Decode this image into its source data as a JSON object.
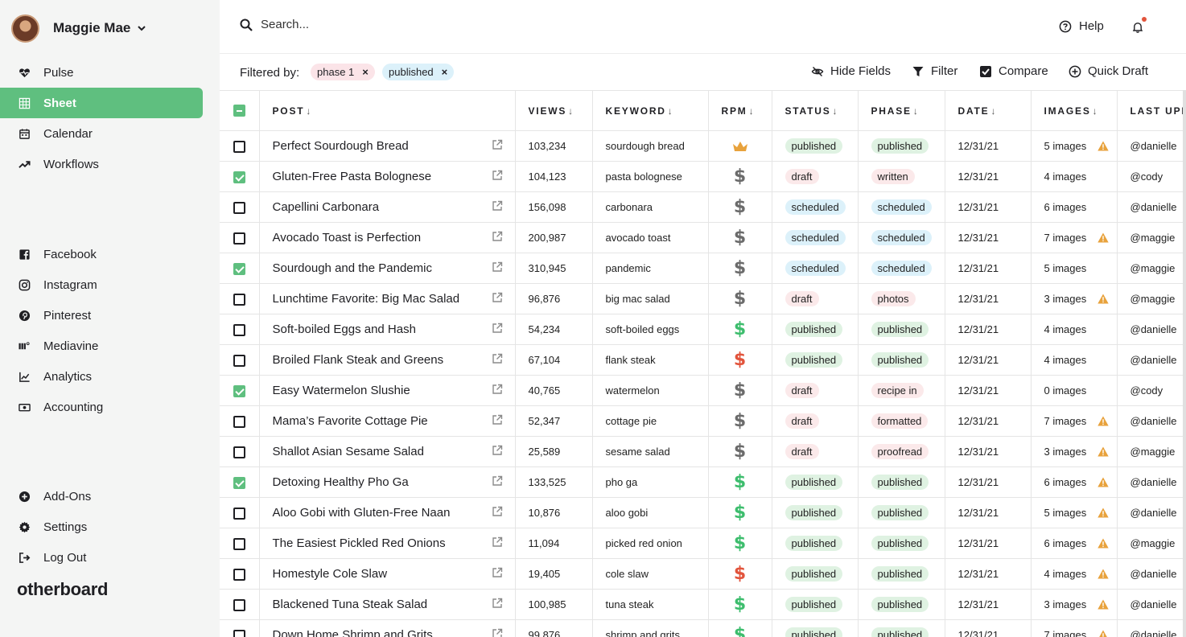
{
  "user": {
    "name": "Maggie Mae"
  },
  "nav_primary": [
    {
      "label": "Pulse",
      "icon": "heart-pulse-icon"
    },
    {
      "label": "Sheet",
      "icon": "grid-icon",
      "active": true
    },
    {
      "label": "Calendar",
      "icon": "calendar-icon"
    },
    {
      "label": "Workflows",
      "icon": "trend-icon"
    }
  ],
  "nav_secondary": [
    {
      "label": "Facebook",
      "icon": "facebook-icon"
    },
    {
      "label": "Instagram",
      "icon": "instagram-icon"
    },
    {
      "label": "Pinterest",
      "icon": "pinterest-icon"
    },
    {
      "label": "Mediavine",
      "icon": "mediavine-icon"
    },
    {
      "label": "Analytics",
      "icon": "analytics-icon"
    },
    {
      "label": "Accounting",
      "icon": "accounting-icon"
    }
  ],
  "nav_bottom": [
    {
      "label": "Add-Ons",
      "icon": "plus-circle-icon"
    },
    {
      "label": "Settings",
      "icon": "gear-icon"
    },
    {
      "label": "Log Out",
      "icon": "logout-icon"
    }
  ],
  "brand": "otherboard",
  "search": {
    "placeholder": "Search..."
  },
  "help_label": "Help",
  "filter": {
    "label": "Filtered by:",
    "chips": [
      {
        "label": "phase 1",
        "x": "×"
      },
      {
        "label": "published",
        "x": "×"
      }
    ]
  },
  "actions": {
    "hide_fields": "Hide Fields",
    "filter": "Filter",
    "compare": "Compare",
    "quick_draft": "Quick Draft"
  },
  "columns": {
    "post": "POST",
    "views": "VIEWS",
    "keyword": "KEYWORD",
    "rpm": "RPM",
    "status": "STATUS",
    "phase": "PHASE",
    "date": "DATE",
    "images": "IMAGES",
    "last_updated": "LAST UPD"
  },
  "sort_arrow": "↓",
  "rows": [
    {
      "checked": false,
      "post": "Perfect Sourdough Bread",
      "views": "103,234",
      "keyword": "sourdough bread",
      "rpm": "crown",
      "status": "published",
      "phase": "published",
      "date": "12/31/21",
      "images": "5 images",
      "warn": true,
      "user": "@danielle"
    },
    {
      "checked": true,
      "post": "Gluten-Free Pasta Bolognese",
      "views": "104,123",
      "keyword": "pasta bolognese",
      "rpm": "grey",
      "status": "draft",
      "phase": "written",
      "date": "12/31/21",
      "images": "4 images",
      "warn": false,
      "user": "@cody"
    },
    {
      "checked": false,
      "post": "Capellini Carbonara",
      "views": "156,098",
      "keyword": "carbonara",
      "rpm": "grey",
      "status": "scheduled",
      "phase": "scheduled",
      "date": "12/31/21",
      "images": "6 images",
      "warn": false,
      "user": "@danielle"
    },
    {
      "checked": false,
      "post": "Avocado Toast is Perfection",
      "views": "200,987",
      "keyword": "avocado toast",
      "rpm": "grey",
      "status": "scheduled",
      "phase": "scheduled",
      "date": "12/31/21",
      "images": "7 images",
      "warn": true,
      "user": "@maggie"
    },
    {
      "checked": true,
      "post": "Sourdough and the Pandemic",
      "views": "310,945",
      "keyword": "pandemic",
      "rpm": "grey",
      "status": "scheduled",
      "phase": "scheduled",
      "date": "12/31/21",
      "images": "5 images",
      "warn": false,
      "user": "@maggie"
    },
    {
      "checked": false,
      "post": "Lunchtime Favorite: Big Mac Salad",
      "views": "96,876",
      "keyword": "big mac salad",
      "rpm": "grey",
      "status": "draft",
      "phase": "photos",
      "date": "12/31/21",
      "images": "3 images",
      "warn": true,
      "user": "@maggie"
    },
    {
      "checked": false,
      "post": "Soft-boiled Eggs and Hash",
      "views": "54,234",
      "keyword": "soft-boiled eggs",
      "rpm": "green",
      "status": "published",
      "phase": "published",
      "date": "12/31/21",
      "images": "4 images",
      "warn": false,
      "user": "@danielle"
    },
    {
      "checked": false,
      "post": "Broiled Flank Steak and Greens",
      "views": "67,104",
      "keyword": "flank steak",
      "rpm": "red",
      "status": "published",
      "phase": "published",
      "date": "12/31/21",
      "images": "4 images",
      "warn": false,
      "user": "@danielle"
    },
    {
      "checked": true,
      "post": "Easy Watermelon Slushie",
      "views": "40,765",
      "keyword": "watermelon",
      "rpm": "grey",
      "status": "draft",
      "phase": "recipe in",
      "date": "12/31/21",
      "images": "0 images",
      "warn": false,
      "user": "@cody"
    },
    {
      "checked": false,
      "post": "Mama’s Favorite Cottage Pie",
      "views": "52,347",
      "keyword": "cottage pie",
      "rpm": "grey",
      "status": "draft",
      "phase": "formatted",
      "date": "12/31/21",
      "images": "7 images",
      "warn": true,
      "user": "@danielle"
    },
    {
      "checked": false,
      "post": "Shallot Asian Sesame Salad",
      "views": "25,589",
      "keyword": "sesame salad",
      "rpm": "grey",
      "status": "draft",
      "phase": "proofread",
      "date": "12/31/21",
      "images": "3 images",
      "warn": true,
      "user": "@maggie"
    },
    {
      "checked": true,
      "post": "Detoxing Healthy Pho Ga",
      "views": "133,525",
      "keyword": "pho ga",
      "rpm": "green",
      "status": "published",
      "phase": "published",
      "date": "12/31/21",
      "images": "6 images",
      "warn": true,
      "user": "@danielle"
    },
    {
      "checked": false,
      "post": "Aloo Gobi with Gluten-Free Naan",
      "views": "10,876",
      "keyword": "aloo gobi",
      "rpm": "green",
      "status": "published",
      "phase": "published",
      "date": "12/31/21",
      "images": "5 images",
      "warn": true,
      "user": "@danielle"
    },
    {
      "checked": false,
      "post": "The Easiest Pickled Red Onions",
      "views": "11,094",
      "keyword": "picked red onion",
      "rpm": "green",
      "status": "published",
      "phase": "published",
      "date": "12/31/21",
      "images": "6 images",
      "warn": true,
      "user": "@maggie"
    },
    {
      "checked": false,
      "post": "Homestyle Cole Slaw",
      "views": "19,405",
      "keyword": "cole slaw",
      "rpm": "red",
      "status": "published",
      "phase": "published",
      "date": "12/31/21",
      "images": "4 images",
      "warn": true,
      "user": "@danielle"
    },
    {
      "checked": false,
      "post": "Blackened Tuna Steak Salad",
      "views": "100,985",
      "keyword": "tuna steak",
      "rpm": "green",
      "status": "published",
      "phase": "published",
      "date": "12/31/21",
      "images": "3 images",
      "warn": true,
      "user": "@danielle"
    },
    {
      "checked": false,
      "post": "Down Home Shrimp and Grits",
      "views": "99,876",
      "keyword": "shrimp and grits",
      "rpm": "green",
      "status": "published",
      "phase": "published",
      "date": "12/31/21",
      "images": "7 images",
      "warn": true,
      "user": "@danielle"
    }
  ],
  "rpm_symbol": "$",
  "colors": {
    "accent": "#5fbf7f",
    "published": "#dff2e2",
    "draft": "#fbe9ea",
    "scheduled": "#dcf1fa",
    "warn": "#e8a23c",
    "red": "#e2543c"
  }
}
